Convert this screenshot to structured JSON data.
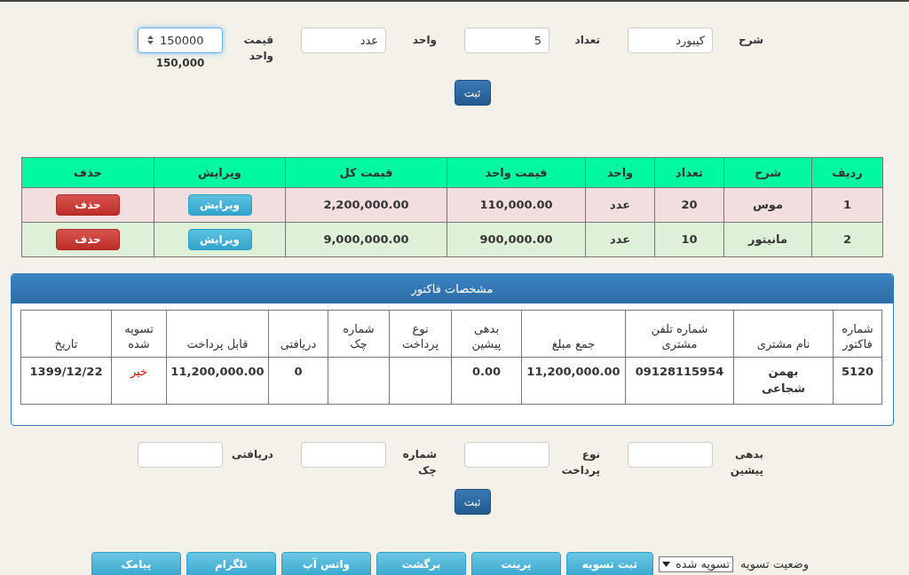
{
  "item_form": {
    "fields": [
      {
        "label": "شرح",
        "value": "کیبورد",
        "kind": "text",
        "focused": false
      },
      {
        "label": "تعداد",
        "value": "5",
        "kind": "text",
        "focused": false
      },
      {
        "label": "واحد",
        "value": "عدد",
        "kind": "text",
        "focused": false
      },
      {
        "label": "قیمت واحد",
        "value": "150000",
        "kind": "number",
        "focused": true,
        "hint": "150,000"
      }
    ],
    "submit": "ثبت"
  },
  "items_table": {
    "columns": [
      "ردیف",
      "شرح",
      "تعداد",
      "واحد",
      "قیمت واحد",
      "قیمت کل",
      "ویرایش",
      "حذف"
    ],
    "rows": [
      {
        "kind": "danger",
        "cells": [
          "1",
          "موس",
          "20",
          "عدد",
          "110,000.00",
          "2,200,000.00"
        ],
        "edit": "ویرایش",
        "delete": "حذف"
      },
      {
        "kind": "success",
        "cells": [
          "2",
          "مانیتور",
          "10",
          "عدد",
          "900,000.00",
          "9,000,000.00"
        ],
        "edit": "ویرایش",
        "delete": "حذف"
      }
    ]
  },
  "invoice_panel": {
    "title": "مشخصات فاکتور",
    "columns": [
      "شماره\nفاکتور",
      "نام مشتری",
      "شماره تلفن\nمشتری",
      "جمع مبلغ",
      "بدهی\nپیشین",
      "نوع\nپرداخت",
      "شماره\nچک",
      "دریافتی",
      "قابل پرداخت",
      "تسویه\nشده",
      "تاریخ"
    ],
    "rows": [
      {
        "settled": false,
        "cells": [
          "5120",
          "بهمن\nشجاعی",
          "09128115954",
          "11,200,000.00",
          "0.00",
          "",
          "",
          "0",
          "11,200,000.00",
          "خیر",
          "1399/12/22"
        ]
      }
    ]
  },
  "payment_form": {
    "fields": [
      {
        "label": "بدهی پیشین"
      },
      {
        "label": "نوع پرداخت"
      },
      {
        "label": "شماره چک"
      },
      {
        "label": "دریافتی"
      }
    ],
    "submit": "ثبت"
  },
  "footer": {
    "status_label": "وضعیت تسویه",
    "status_value": "تسویه شده",
    "buttons": [
      "ثبت تسویه",
      "پرینت",
      "برگشت",
      "واتس آپ",
      "تلگرام",
      "پیامک"
    ]
  }
}
